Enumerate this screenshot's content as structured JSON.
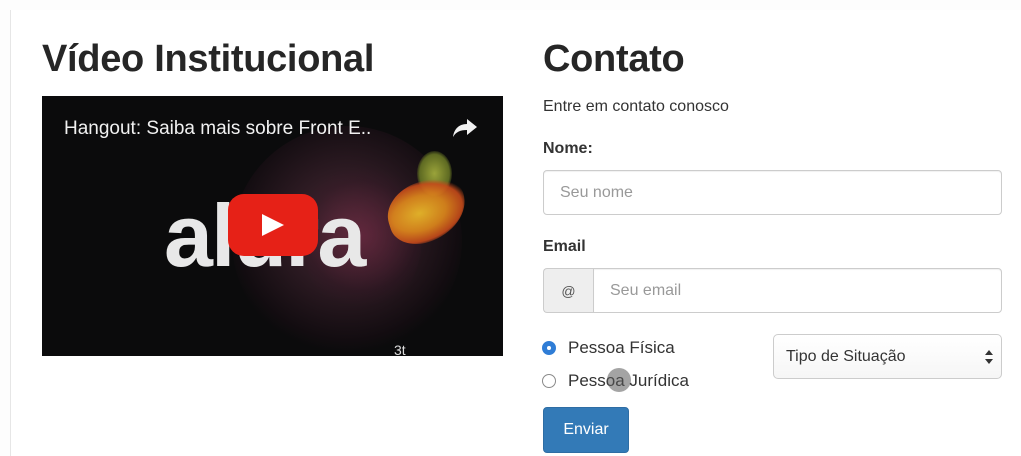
{
  "video_section": {
    "title": "Vídeo Institucional",
    "video": {
      "title": "Hangout: Saiba mais sobre Front E..",
      "brand_text": "alura",
      "corner_text": "3t",
      "share_icon": "share-arrow-icon",
      "play_icon": "youtube-play-icon",
      "play_color": "#e62117"
    }
  },
  "contact_section": {
    "title": "Contato",
    "lead": "Entre em contato conosco",
    "name_label": "Nome:",
    "name_placeholder": "Seu nome",
    "email_label": "Email",
    "email_addon": "@",
    "email_placeholder": "Seu email",
    "person_types": [
      {
        "label": "Pessoa Física",
        "checked": true
      },
      {
        "label": "Pessoa Jurídica",
        "checked": false
      }
    ],
    "situation_select": "Tipo de Situação",
    "submit_label": "Enviar",
    "accent_color": "#337ab7"
  }
}
